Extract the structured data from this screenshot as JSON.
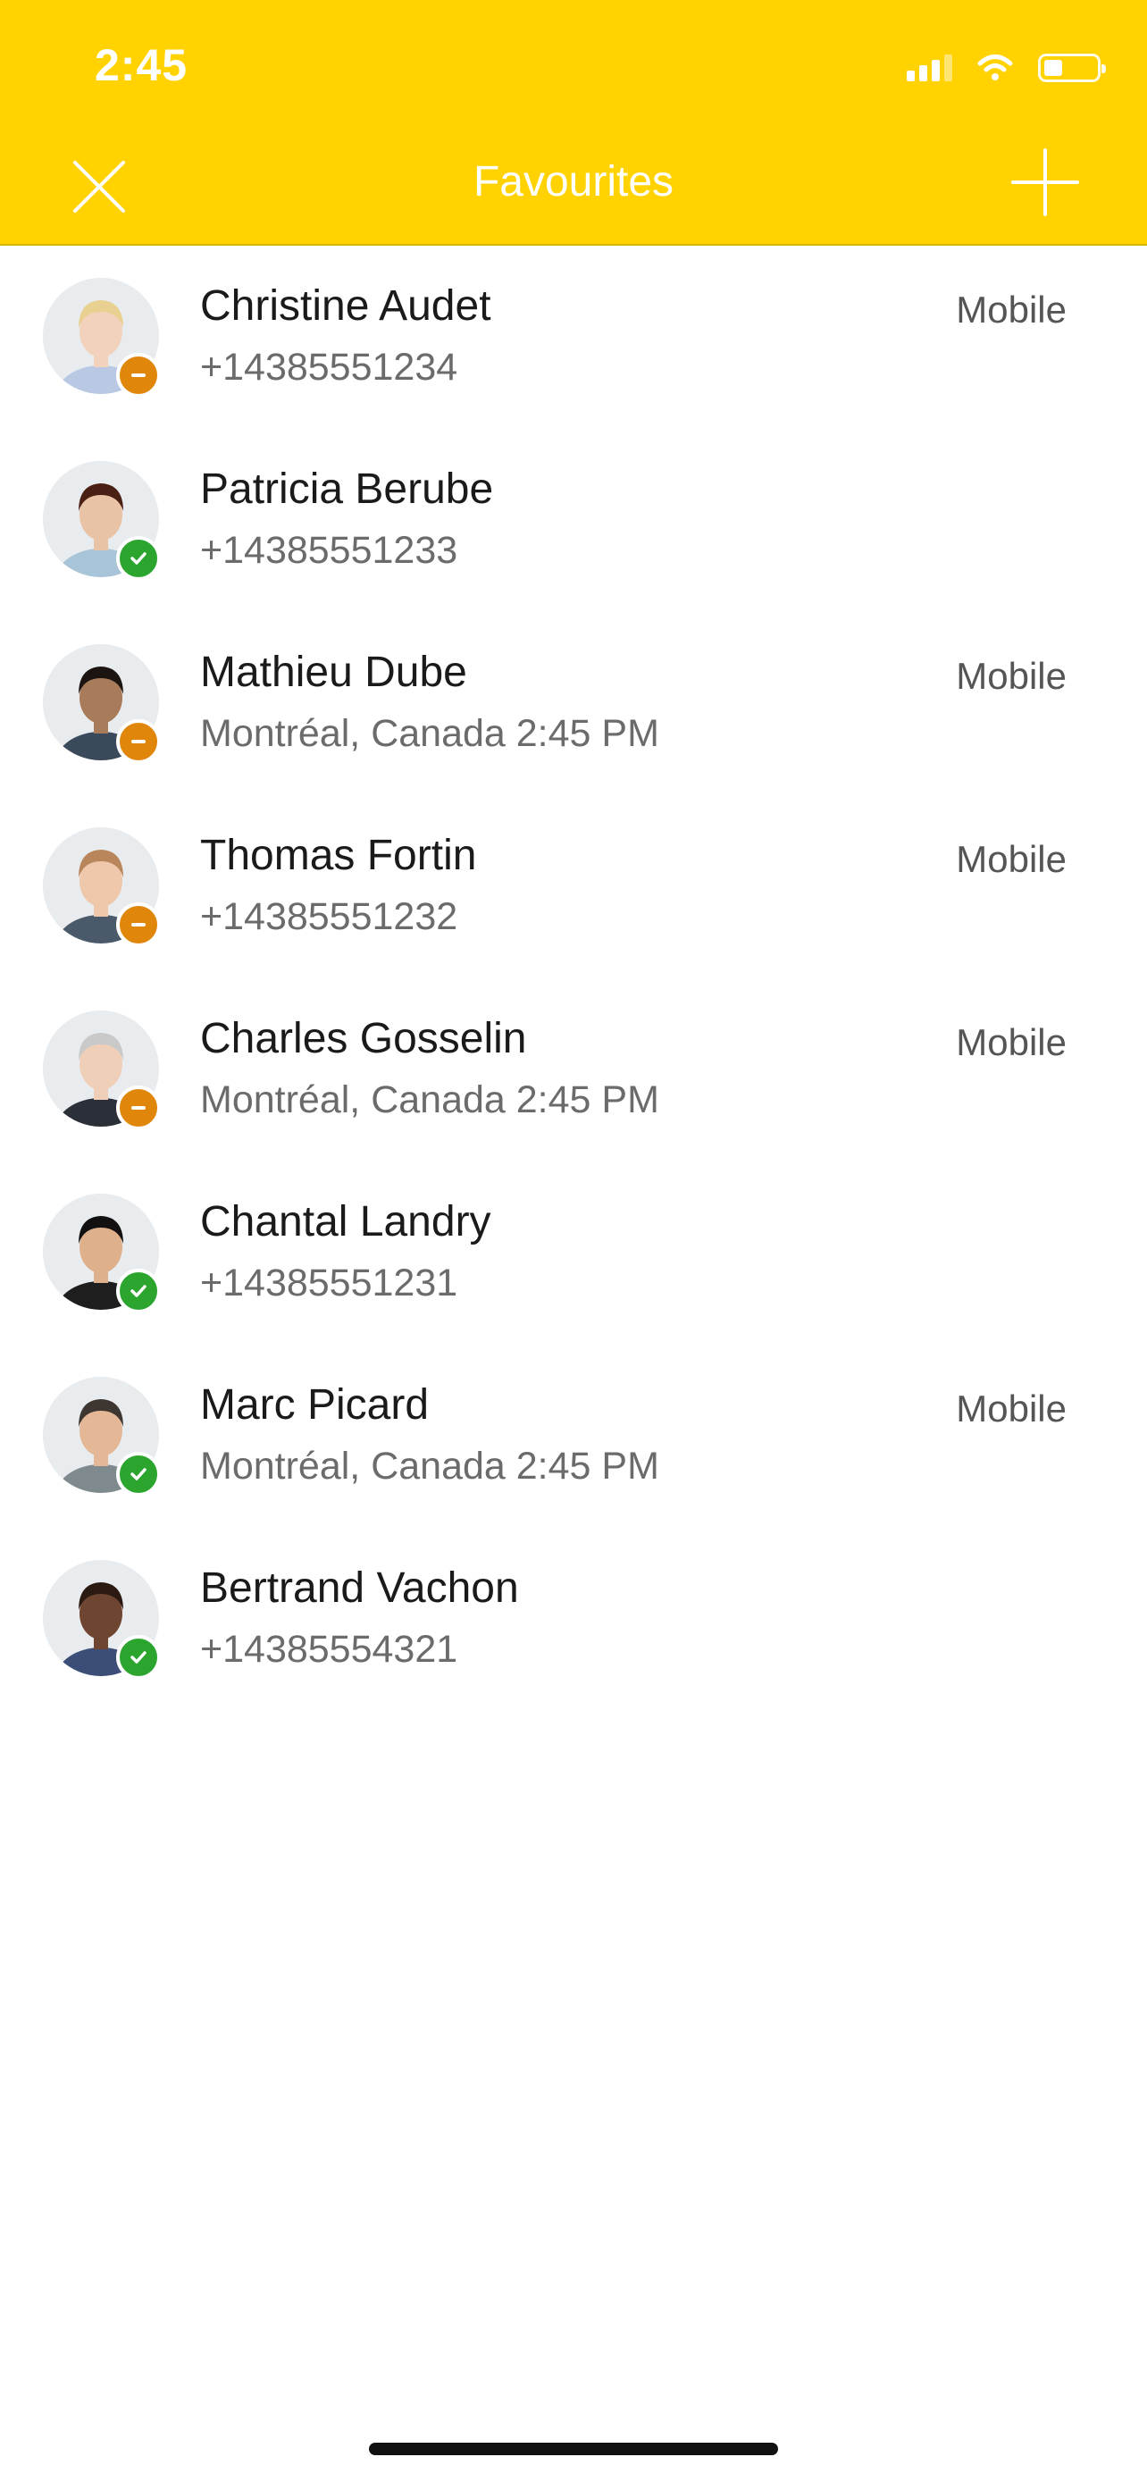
{
  "status_bar": {
    "time": "2:45"
  },
  "nav": {
    "title": "Favourites"
  },
  "contacts": [
    {
      "name": "Christine Audet",
      "detail": "+14385551234",
      "label": "Mobile",
      "presence": "away",
      "skin": "#f3d2bd",
      "hair": "#e8d090",
      "shirt": "#b9c9e3"
    },
    {
      "name": "Patricia Berube",
      "detail": "+14385551233",
      "label": "",
      "presence": "available",
      "skin": "#e9c3a6",
      "hair": "#4a1f14",
      "shirt": "#a8c4d8"
    },
    {
      "name": "Mathieu Dube",
      "detail": "Montréal, Canada 2:45 PM",
      "label": "Mobile",
      "presence": "away",
      "skin": "#a87b5a",
      "hair": "#1c1410",
      "shirt": "#3a4a5a"
    },
    {
      "name": "Thomas Fortin",
      "detail": "+14385551232",
      "label": "Mobile",
      "presence": "away",
      "skin": "#efc8ab",
      "hair": "#b8865a",
      "shirt": "#4a5a6a"
    },
    {
      "name": "Charles Gosselin",
      "detail": "Montréal, Canada 2:45 PM",
      "label": "Mobile",
      "presence": "away",
      "skin": "#f0cfb8",
      "hair": "#c9c9c9",
      "shirt": "#2b2f38"
    },
    {
      "name": "Chantal Landry",
      "detail": "+14385551231",
      "label": "",
      "presence": "available",
      "skin": "#dfb08c",
      "hair": "#121010",
      "shirt": "#1e1e1e"
    },
    {
      "name": "Marc Picard",
      "detail": "Montréal, Canada 2:45 PM",
      "label": "Mobile",
      "presence": "available",
      "skin": "#e4b896",
      "hair": "#3d3631",
      "shirt": "#7f8a8f"
    },
    {
      "name": "Bertrand Vachon",
      "detail": "+14385554321",
      "label": "",
      "presence": "available",
      "skin": "#6e4530",
      "hair": "#2a1a12",
      "shirt": "#3c4e78"
    }
  ],
  "colors": {
    "header_bg": "#FFD200",
    "presence_away": "#E0860B",
    "presence_available": "#2BA52E"
  },
  "icons": {
    "close": "close-icon",
    "add": "plus-icon",
    "away": "minus-icon",
    "available": "checkmark-icon"
  }
}
